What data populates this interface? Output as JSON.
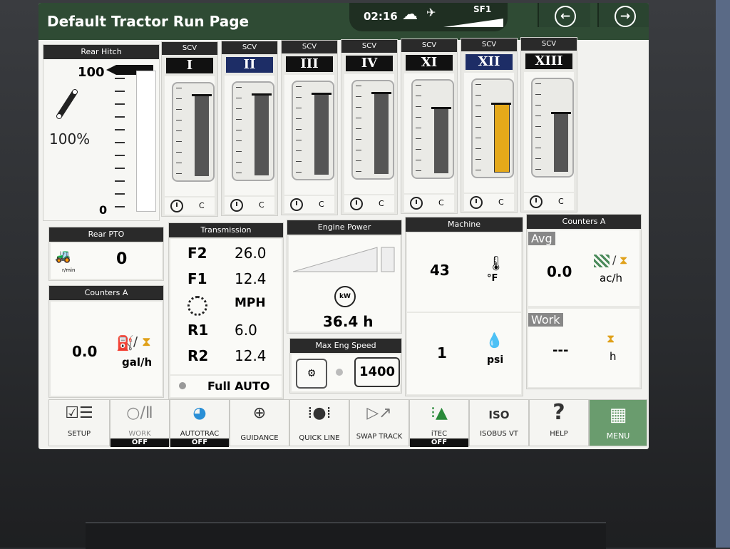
{
  "header": {
    "title": "Default Tractor Run Page"
  },
  "status": {
    "time": "02:16",
    "signal_label": "SF1"
  },
  "rear_hitch": {
    "title": "Rear Hitch",
    "top_value": "100",
    "bottom_value": "0",
    "percent": "100%"
  },
  "scv": {
    "label": "SCV",
    "items": [
      {
        "numeral": "I",
        "foot": "C",
        "level": 0.92,
        "highlight": false,
        "blue": false
      },
      {
        "numeral": "II",
        "foot": "C",
        "level": 0.92,
        "highlight": false,
        "blue": true
      },
      {
        "numeral": "III",
        "foot": "C",
        "level": 0.92,
        "highlight": false,
        "blue": false
      },
      {
        "numeral": "IV",
        "foot": "C",
        "level": 0.92,
        "highlight": false,
        "blue": false
      },
      {
        "numeral": "XI",
        "foot": "C",
        "level": 0.74,
        "highlight": false,
        "blue": false
      },
      {
        "numeral": "XII",
        "foot": "C",
        "level": 0.78,
        "highlight": true,
        "blue": true
      },
      {
        "numeral": "XIII",
        "foot": "C",
        "level": 0.66,
        "highlight": false,
        "blue": false
      }
    ]
  },
  "rear_pto": {
    "title": "Rear PTO",
    "value": "0",
    "unit": "r/min"
  },
  "counters_a_left": {
    "title": "Counters A",
    "value": "0.0",
    "unit": "gal/h"
  },
  "transmission": {
    "title": "Transmission",
    "rows": [
      {
        "key": "F2",
        "value": "26.0"
      },
      {
        "key": "F1",
        "value": "12.4"
      },
      {
        "key": "",
        "value": "MPH"
      },
      {
        "key": "R1",
        "value": "6.0"
      },
      {
        "key": "R2",
        "value": "12.4"
      }
    ],
    "mode": "Full AUTO"
  },
  "engine_power": {
    "title": "Engine Power",
    "value": "36.4 h",
    "icon_text": "kW"
  },
  "max_eng_speed": {
    "title": "Max Eng Speed",
    "value": "1400"
  },
  "machine": {
    "title": "Machine",
    "temp_value": "43",
    "temp_unit": "°F",
    "pressure_value": "1",
    "pressure_unit": "psi"
  },
  "counters_a_right": {
    "title": "Counters A",
    "avg_label": "Avg",
    "avg_value": "0.0",
    "avg_unit": "ac/h",
    "work_label": "Work",
    "work_value": "---",
    "work_unit": "h"
  },
  "toolbar": [
    {
      "name": "setup",
      "label": "SETUP",
      "off": ""
    },
    {
      "name": "work",
      "label": "WORK",
      "off": "OFF"
    },
    {
      "name": "autotrac",
      "label": "AUTOTRAC",
      "off": "OFF"
    },
    {
      "name": "guidance",
      "label": "GUIDANCE",
      "off": ""
    },
    {
      "name": "quick-line",
      "label": "QUICK LINE",
      "off": ""
    },
    {
      "name": "swap-track",
      "label": "SWAP TRACK",
      "off": ""
    },
    {
      "name": "itec",
      "label": "iTEC",
      "off": "OFF"
    },
    {
      "name": "isobus-vt",
      "label": "ISOBUS VT",
      "off": ""
    },
    {
      "name": "help",
      "label": "HELP",
      "off": ""
    },
    {
      "name": "menu",
      "label": "MENU",
      "off": ""
    }
  ],
  "colors": {
    "header": "#2f4b34",
    "scv_highlight": "#e5a91a",
    "menu_bg": "#6a9c6e"
  }
}
